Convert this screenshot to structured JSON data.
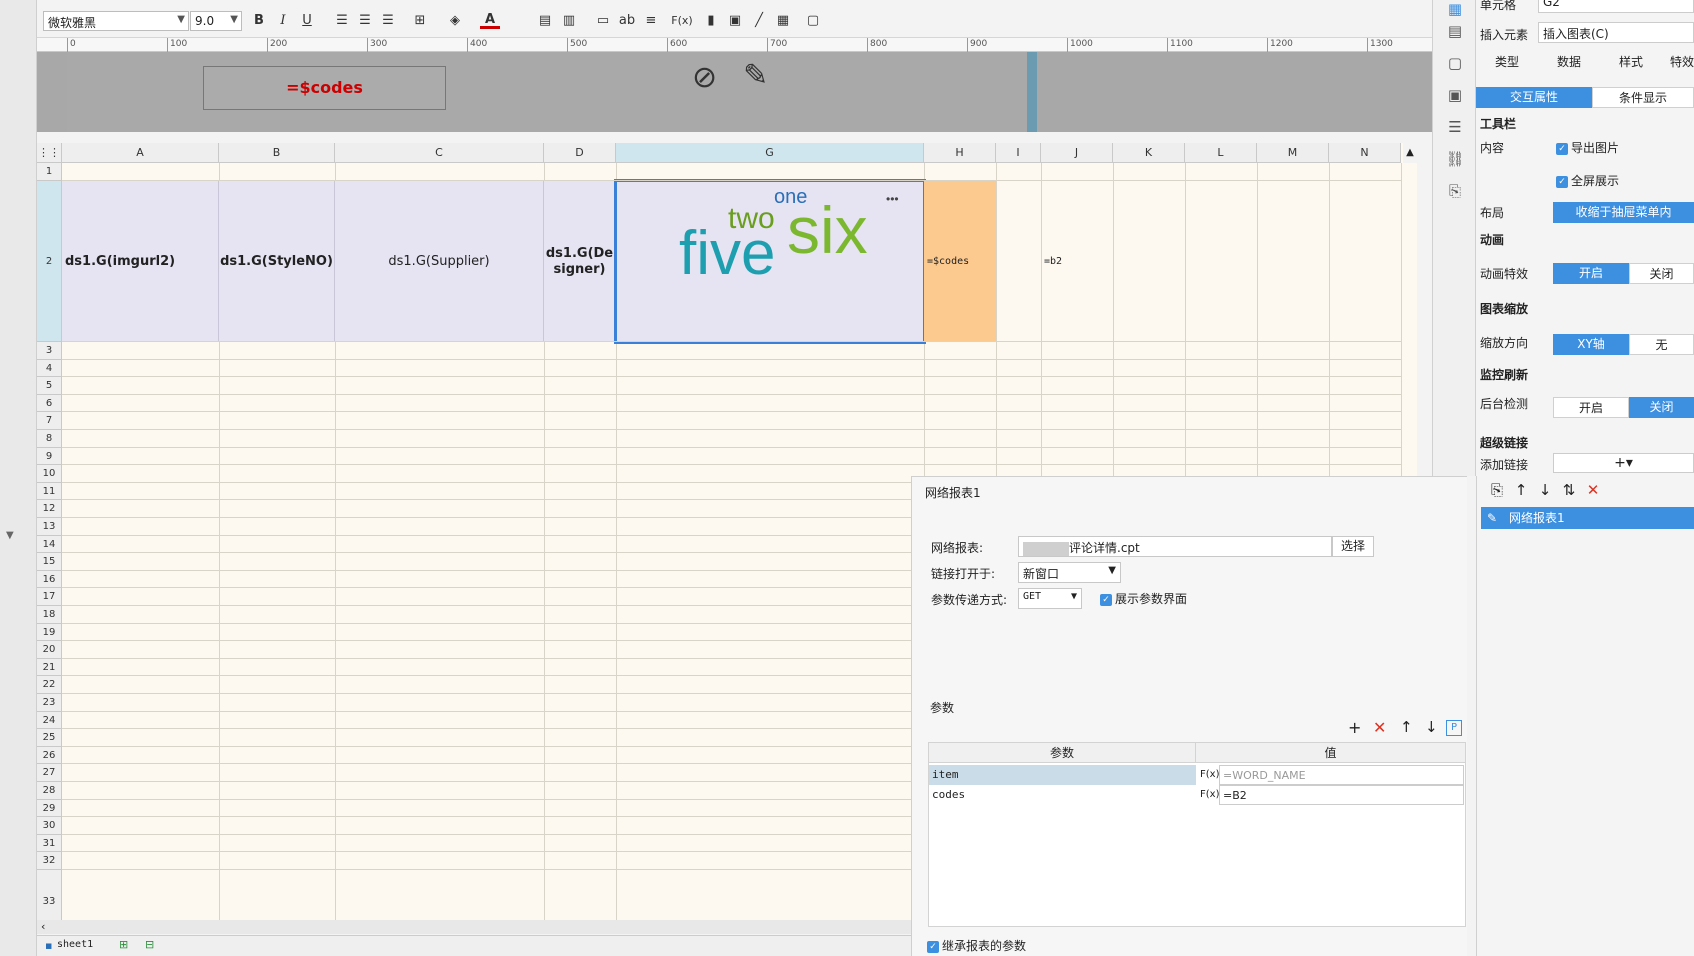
{
  "toolbar": {
    "font_name": "微软雅黑",
    "font_size": "9.0",
    "icons": [
      "bold-icon",
      "italic-icon",
      "underline-icon",
      "align-left-icon",
      "align-center-icon",
      "align-right-icon",
      "border-icon",
      "fill-color-icon",
      "font-color-icon",
      "merge-icon",
      "unmerge-icon",
      "text-icon",
      "wrap-icon",
      "formula-icon",
      "chart-icon",
      "image-icon",
      "slash-icon",
      "richtext-icon",
      "frame-icon"
    ],
    "bold_label": "B",
    "italic_label": "I",
    "underline_label": "U",
    "text_label": "ab",
    "formula_label": "F(x)"
  },
  "ruler": {
    "ticks": [
      "0",
      "100",
      "200",
      "300",
      "400",
      "500",
      "600",
      "700",
      "800",
      "900",
      "1000",
      "1100",
      "1200",
      "1300"
    ]
  },
  "preview": {
    "formula": "=$codes"
  },
  "grid": {
    "columns": [
      "A",
      "B",
      "C",
      "D",
      "G",
      "H",
      "I",
      "J",
      "K",
      "L",
      "M",
      "N"
    ],
    "rows": [
      "1",
      "2",
      "3",
      "4",
      "5",
      "6",
      "7",
      "8",
      "9",
      "10",
      "11",
      "12",
      "13",
      "14",
      "15",
      "16",
      "17",
      "18",
      "19",
      "20",
      "21",
      "22",
      "23",
      "24",
      "25",
      "26",
      "27",
      "28",
      "29",
      "30",
      "31",
      "32",
      "33"
    ],
    "cells": {
      "a2": "ds1.G(imgurl2)",
      "b2": "ds1.G(StyleNO)",
      "c2": "ds1.G(Supplier)",
      "d2": "ds1.G(Designer)",
      "h2": "=$codes",
      "j2": "=b2"
    },
    "wordcloud": {
      "words": [
        "one",
        "two",
        "six",
        "five"
      ]
    },
    "more_label": "•••"
  },
  "sheets": {
    "tab": "sheet1"
  },
  "properties": {
    "cell_label": "单元格",
    "cell_value": "G2",
    "insert_label": "插入元素",
    "insert_value": "插入图表(C)",
    "tabs": [
      "类型",
      "数据",
      "样式",
      "特效"
    ],
    "subtabs": [
      "交互属性",
      "条件显示"
    ],
    "toolbar_section": "工具栏",
    "content_label": "内容",
    "export_image": "导出图片",
    "fullscreen": "全屏展示",
    "layout_label": "布局",
    "layout_value": "收缩于抽屉菜单内",
    "animation_section": "动画",
    "animation_label": "动画特效",
    "animation_on": "开启",
    "animation_off": "关闭",
    "zoom_section": "图表缩放",
    "zoom_dir_label": "缩放方向",
    "zoom_xy": "XY轴",
    "zoom_none": "无",
    "monitor_section": "监控刷新",
    "bg_check_label": "后台检测",
    "bg_on": "开启",
    "bg_off": "关闭",
    "hyperlink_section": "超级链接",
    "add_link_label": "添加链接",
    "add_link_button": "+▾"
  },
  "dialog": {
    "title": "网络报表1",
    "report_label": "网络报表:",
    "report_value": "评论详情.cpt",
    "choose_button": "选择",
    "open_in_label": "链接打开于:",
    "open_in_value": "新窗口",
    "method_label": "参数传递方式:",
    "method_value": "GET",
    "show_params": "展示参数界面",
    "params_label": "参数",
    "param_col": "参数",
    "value_col": "值",
    "params": [
      {
        "name": "item",
        "value": "=WORD_NAME"
      },
      {
        "name": "codes",
        "value": "=B2"
      }
    ],
    "inherit_params": "继承报表的参数"
  },
  "linklist": {
    "items": [
      "网络报表1"
    ]
  }
}
